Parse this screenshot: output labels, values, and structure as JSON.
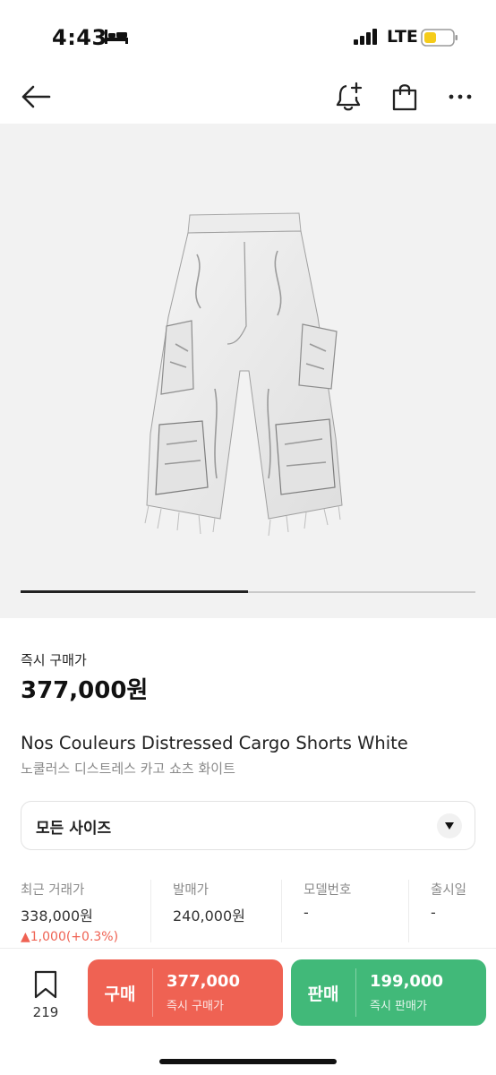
{
  "status_bar": {
    "time": "4:43",
    "network": "LTE"
  },
  "nav": {
    "icons": [
      "back-arrow-icon",
      "bell-plus-icon",
      "shopping-bag-icon",
      "more-icon"
    ]
  },
  "carousel": {
    "progress": 0.5
  },
  "price": {
    "label": "즉시 구매가",
    "value": "377,000원"
  },
  "product": {
    "title": "Nos Couleurs Distressed Cargo Shorts White",
    "subtitle": "노쿨러스 디스트레스 카고 쇼츠 화이트"
  },
  "size_select": {
    "label": "모든 사이즈"
  },
  "info": {
    "recent_trade": {
      "label": "최근 거래가",
      "value": "338,000원",
      "change": "▲1,000(+0.3%)"
    },
    "release_price": {
      "label": "발매가",
      "value": "240,000원"
    },
    "model_number": {
      "label": "모델번호",
      "value": "-"
    },
    "release_date": {
      "label": "출시일",
      "value": "-"
    }
  },
  "bottom_bar": {
    "bookmark_count": "219",
    "buy": {
      "kind": "구매",
      "price": "377,000",
      "sub": "즉시 구매가"
    },
    "sell": {
      "kind": "판매",
      "price": "199,000",
      "sub": "즉시 판매가"
    }
  },
  "colors": {
    "buy": "#ef6253",
    "sell": "#41b979",
    "price_up": "#ef6253"
  }
}
